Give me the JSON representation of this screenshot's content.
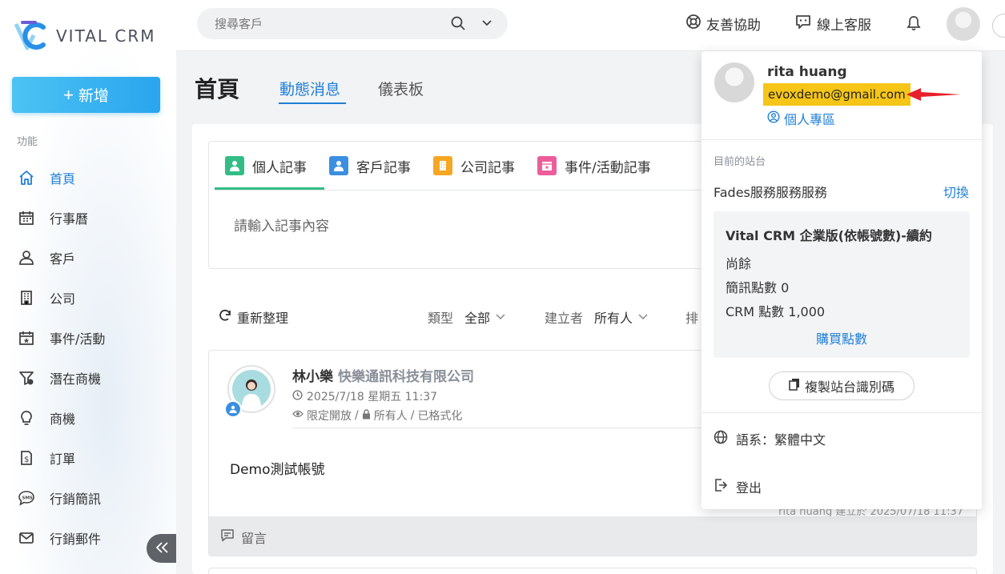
{
  "brand": {
    "name": "VITAL CRM"
  },
  "sidebar": {
    "new_label": "新增",
    "section_label": "功能",
    "items": [
      {
        "label": "首頁",
        "icon": "home-icon"
      },
      {
        "label": "行事曆",
        "icon": "calendar-icon"
      },
      {
        "label": "客戶",
        "icon": "customer-icon"
      },
      {
        "label": "公司",
        "icon": "building-icon"
      },
      {
        "label": "事件/活動",
        "icon": "event-icon"
      },
      {
        "label": "潛在商機",
        "icon": "funnel-icon"
      },
      {
        "label": "商機",
        "icon": "bulb-icon"
      },
      {
        "label": "訂單",
        "icon": "order-icon"
      },
      {
        "label": "行銷簡訊",
        "icon": "sms-icon"
      },
      {
        "label": "行銷郵件",
        "icon": "mail-icon"
      }
    ]
  },
  "topbar": {
    "search_placeholder": "搜尋客戶",
    "help_label": "友善協助",
    "support_label": "線上客服"
  },
  "header": {
    "title": "首頁",
    "tabs": [
      "動態消息",
      "儀表板"
    ]
  },
  "composer": {
    "tabs": [
      "個人記事",
      "客戶記事",
      "公司記事",
      "事件/活動記事"
    ],
    "placeholder": "請輸入記事內容"
  },
  "filters": {
    "refresh_label": "重新整理",
    "type_label": "類型",
    "type_value": "全部",
    "creator_label": "建立者",
    "creator_value": "所有人",
    "sort_label": "排"
  },
  "post": {
    "name": "林小樂",
    "company": "快樂通訊科技有限公司",
    "datetime": "2025/7/18 星期五 11:37",
    "visibility": "限定開放",
    "audience": "所有人",
    "format": "已格式化",
    "body": "Demo測試帳號",
    "footer": "rita huang 建立於 2025/07/18 11:37",
    "comment_label": "留言"
  },
  "user_menu": {
    "name": "rita huang",
    "email": "evoxdemo@gmail.com",
    "profile_label": "個人專區",
    "site_section_label": "目前的站台",
    "site_name": "Fades服務服務服務",
    "switch_label": "切換",
    "plan_name": "Vital CRM 企業版(依帳號數)-續約",
    "remaining_label": "尚餘",
    "sms_points": "簡訊點數 0",
    "crm_points": "CRM 點數 1,000",
    "buy_label": "購買點數",
    "copy_label": "複製站台識別碼",
    "language_label": "語系：繁體中文",
    "logout_label": "登出"
  },
  "colors": {
    "accent": "#1f7fd6",
    "highlight": "#f5c518",
    "arrow": "#e8202a",
    "personal_note": "#33bd86",
    "customer_note": "#3b8fe0",
    "company_note": "#f5a623",
    "event_note": "#ec5d9a"
  }
}
